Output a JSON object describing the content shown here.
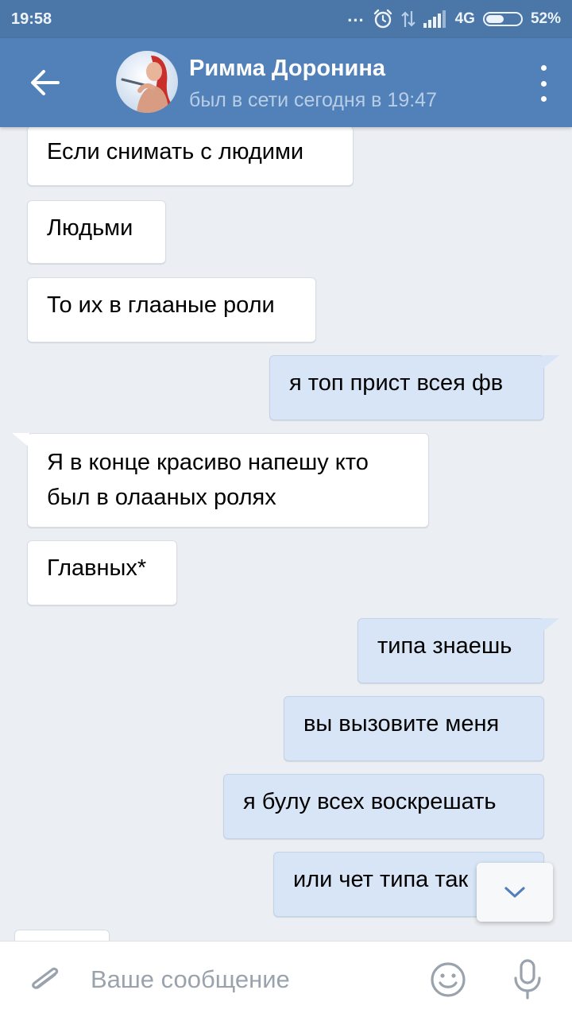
{
  "status_bar": {
    "time": "19:58",
    "dots": "...",
    "network": "4G",
    "battery_percent": "52%",
    "battery_level": 0.52,
    "icons": [
      "alarm-icon",
      "data-arrows-icon",
      "signal-icon",
      "battery-icon"
    ]
  },
  "header": {
    "back_icon": "arrow-left-icon",
    "contact_name": "Римма Доронина",
    "contact_status": "был в сети сегодня в 19:47",
    "menu_icon": "more-vertical-icon"
  },
  "messages": [
    {
      "direction": "in",
      "text": "Если снимать с людими"
    },
    {
      "direction": "in",
      "text": "Людьми"
    },
    {
      "direction": "in",
      "text": "То их в глааные роли"
    },
    {
      "direction": "out",
      "text": "я топ прист всея фв"
    },
    {
      "direction": "in",
      "text": "Я в конце красиво напешу кто"
    },
    {
      "direction": "in",
      "text": "был в олааных ролях"
    },
    {
      "direction": "in",
      "text": "Главных*"
    },
    {
      "direction": "out",
      "text": "типа знаешь"
    },
    {
      "direction": "out",
      "text": "вы вызовите меня"
    },
    {
      "direction": "out",
      "text": "я булу всех воскрешать"
    },
    {
      "direction": "out",
      "text": "или чет типа так"
    }
  ],
  "scroll_down_icon": "chevron-down-icon",
  "composer": {
    "placeholder": "Ваше сообщение",
    "value": "",
    "attach_icon": "paperclip-icon",
    "emoji_icon": "smile-icon",
    "mic_icon": "microphone-icon"
  },
  "colors": {
    "toolbar": "#5181b8",
    "status_bar": "#4a76a8",
    "chat_background": "#ebeef3",
    "incoming_bubble": "#ffffff",
    "outgoing_bubble": "#d7e5f7",
    "accent": "#5181b8"
  }
}
